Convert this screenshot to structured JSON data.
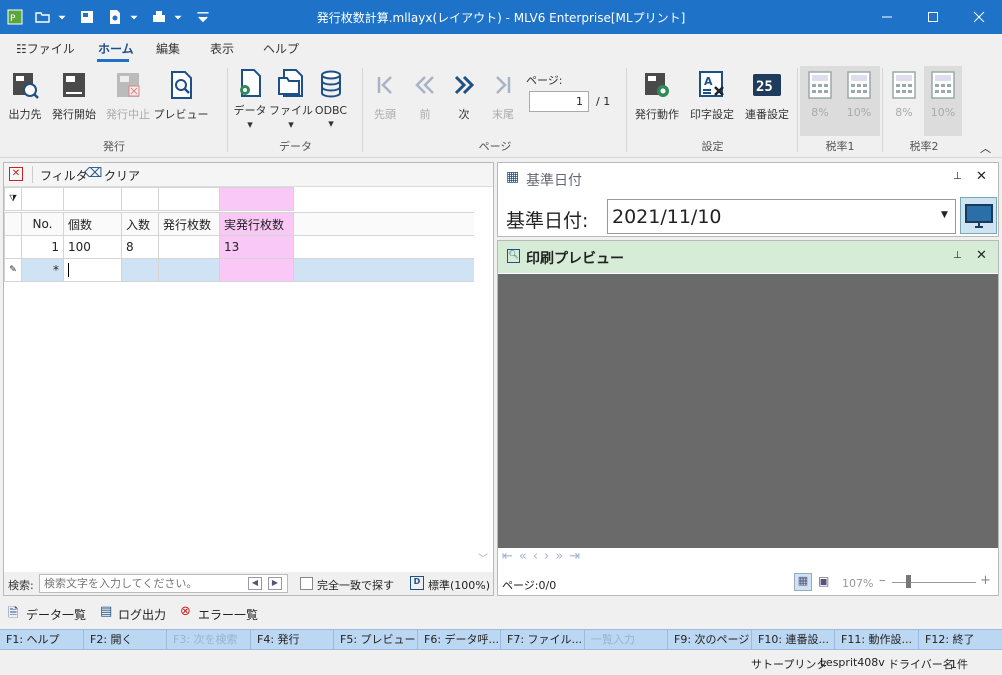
{
  "window": {
    "title": "発行枚数計算.mllayx(レイアウト) - MLV6 Enterprise[MLプリント]"
  },
  "menu": {
    "file": "ファイル",
    "home": "ホーム",
    "edit": "編集",
    "view": "表示",
    "help": "ヘルプ"
  },
  "ribbon": {
    "output_dest": "出力先",
    "issue_start": "発行開始",
    "issue_stop": "発行中止",
    "preview": "プレビュー",
    "group_issue": "発行",
    "data": "データ",
    "file": "ファイル",
    "odbc": "ODBC",
    "group_data": "データ",
    "first": "先頭",
    "prev": "前",
    "next": "次",
    "last": "末尾",
    "page_label": "ページ:",
    "page_value": "1",
    "page_total": "/ 1",
    "group_page": "ページ",
    "issue_action": "発行動作",
    "print_settings": "印字設定",
    "serial_settings": "連番設定",
    "group_settings": "設定",
    "tax1_8": "8%",
    "tax1_10": "10%",
    "group_tax1": "税率1",
    "tax2_8": "8%",
    "tax2_10": "10%",
    "group_tax2": "税率2"
  },
  "grid": {
    "filter": "フィルタ",
    "clear": "クリア",
    "columns": [
      "No.",
      "個数",
      "入数",
      "発行枚数",
      "実発行枚数"
    ],
    "rows": [
      {
        "no": "1",
        "qty": "100",
        "per": "8",
        "issue": "",
        "actual": "13"
      }
    ],
    "new_row_marker": "*",
    "search_label": "検索:",
    "search_placeholder": "検索文字を入力してください。",
    "exact_match": "完全一致で探す",
    "zoom": "標準(100%)"
  },
  "datepane": {
    "title": "基準日付",
    "label": "基準日付:",
    "value": "2021/11/10"
  },
  "previewpane": {
    "title": "印刷プレビュー",
    "page": "ページ:0/0",
    "zoom": "107%"
  },
  "bottomtabs": {
    "data_list": "データ一覧",
    "log_output": "ログ出力",
    "error_list": "エラー一覧"
  },
  "fkeys": [
    "F1: ヘルプ",
    "F2: 開く",
    "F3: 次を検索",
    "F4: 発行",
    "F5: プレビュー",
    "F6: データ呼...",
    "F7: ファイル...",
    "一覧入力",
    "F9: 次のページ",
    "F10: 連番設...",
    "F11: 動作設...",
    "F12: 終了"
  ],
  "status": {
    "printer_label": "サトープリンタ",
    "printer_name": "Lesprit408v",
    "driver_label": "ドライバー名",
    "count": "1件"
  },
  "colors": {
    "titlebar": "#1e73c8",
    "accent": "#1e4f87",
    "pink": "#f9c8f7",
    "row_select": "#cfe3f5",
    "preview_header": "#d6ecd6",
    "preview_bg": "#6a6a6a",
    "fkey_bar": "#bcd7f2"
  }
}
